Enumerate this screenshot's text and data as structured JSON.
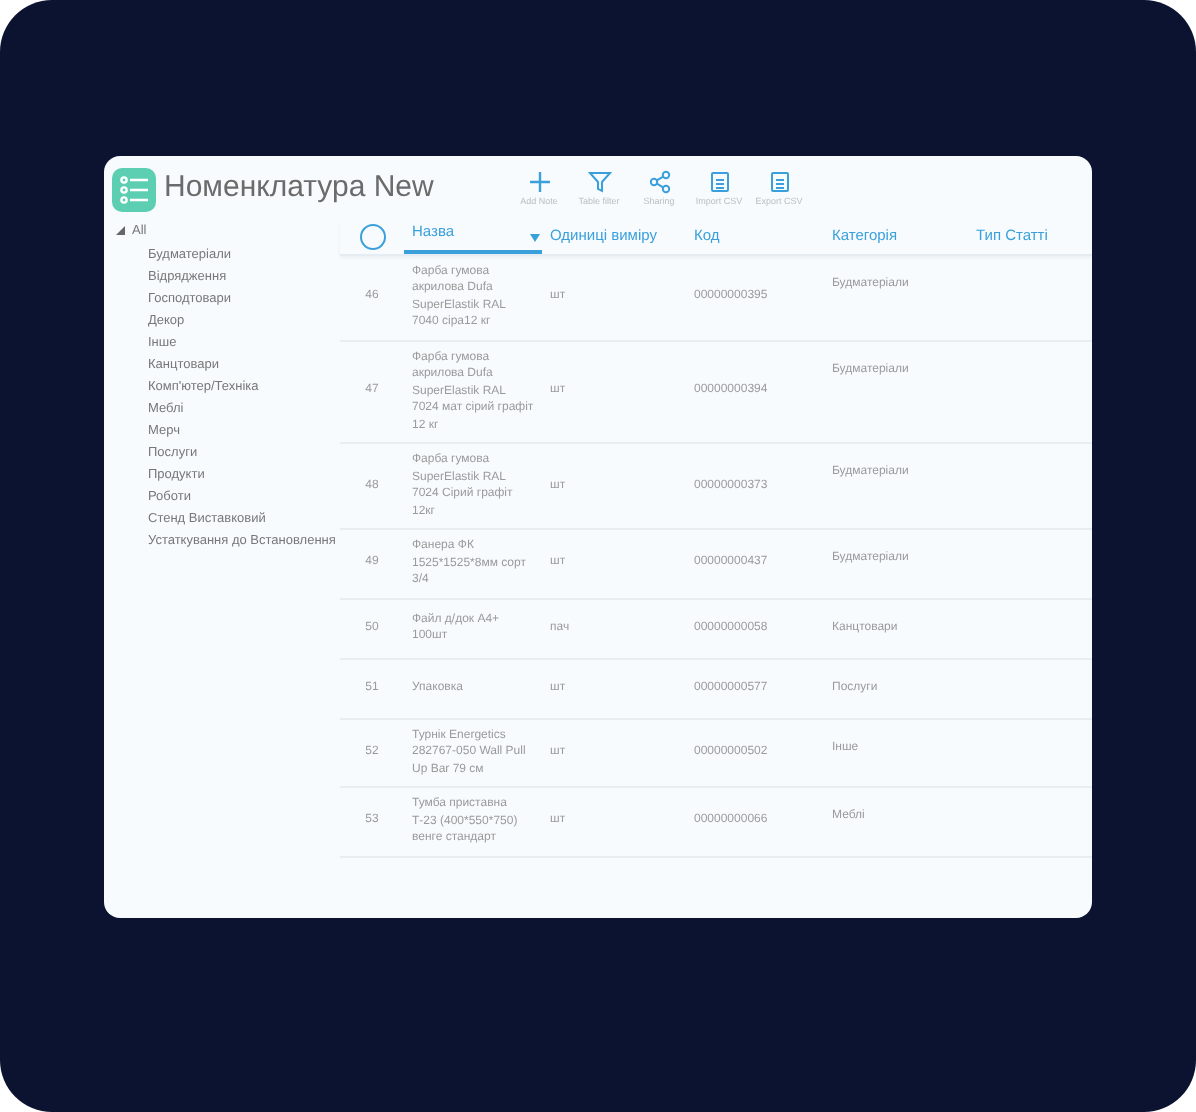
{
  "app": {
    "title": "Номенклатура New"
  },
  "toolbar": [
    {
      "kind": "add",
      "label": "Add Note"
    },
    {
      "kind": "filter",
      "label": "Table filter"
    },
    {
      "kind": "share",
      "label": "Sharing"
    },
    {
      "kind": "import",
      "label": "Import CSV"
    },
    {
      "kind": "export",
      "label": "Export CSV"
    }
  ],
  "tree": {
    "label": "All",
    "expanded": true,
    "children": [
      {
        "label": "Будматеріали"
      },
      {
        "label": "Відрядження"
      },
      {
        "label": "Господтовари"
      },
      {
        "label": "Декор"
      },
      {
        "label": "Інше"
      },
      {
        "label": "Канцтовари"
      },
      {
        "label": "Комп'ютер/Техніка"
      },
      {
        "label": "Меблі"
      },
      {
        "label": "Мерч"
      },
      {
        "label": "Послуги"
      },
      {
        "label": "Продукти"
      },
      {
        "label": "Роботи"
      },
      {
        "label": "Стенд Виставковий"
      },
      {
        "label": "Устаткування до Встановлення"
      }
    ]
  },
  "table": {
    "select_all": {
      "checked": false
    },
    "columns": [
      {
        "label": "Назва",
        "sorted": true
      },
      {
        "label": "Одиниці виміру",
        "sorted": false
      },
      {
        "label": "Код",
        "sorted": false
      },
      {
        "label": "Категорія",
        "sorted": false
      },
      {
        "label": "Тип Статті",
        "sorted": false
      }
    ],
    "rows": [
      {
        "number": "46",
        "name": "Фарба гумова акрилова Dufa SuperElastik RAL 7040 сіра12 кг",
        "unit": "шт",
        "code": "00000000395",
        "category": "Будматеріали"
      },
      {
        "number": "47",
        "name": "Фарба гумова акрилова Dufa SuperElastik RAL 7024 мат сірий графіт 12 кг",
        "unit": "шт",
        "code": "00000000394",
        "category": "Будматеріали"
      },
      {
        "number": "48",
        "name": "Фарба гумова SuperElastik RAL 7024 Сірий графіт 12кг",
        "unit": "шт",
        "code": "00000000373",
        "category": "Будматеріали"
      },
      {
        "number": "49",
        "name": "Фанера ФК 1525*1525*8мм сорт 3/4",
        "unit": "шт",
        "code": "00000000437",
        "category": "Будматеріали"
      },
      {
        "number": "50",
        "name": "Файл д/док А4+ 100шт",
        "unit": "пач",
        "code": "00000000058",
        "category": "Канцтовари"
      },
      {
        "number": "51",
        "name": "Упаковка",
        "unit": "шт",
        "code": "00000000577",
        "category": "Послуги"
      },
      {
        "number": "52",
        "name": "Турнік Energetics 282767-050 Wall Pull Up Bar 79 см",
        "unit": "шт",
        "code": "00000000502",
        "category": "Інше"
      },
      {
        "number": "53",
        "name": "Тумба приставна Т-23 (400*550*750) венге стандарт",
        "unit": "шт",
        "code": "00000000066",
        "category": "Меблі"
      }
    ]
  }
}
